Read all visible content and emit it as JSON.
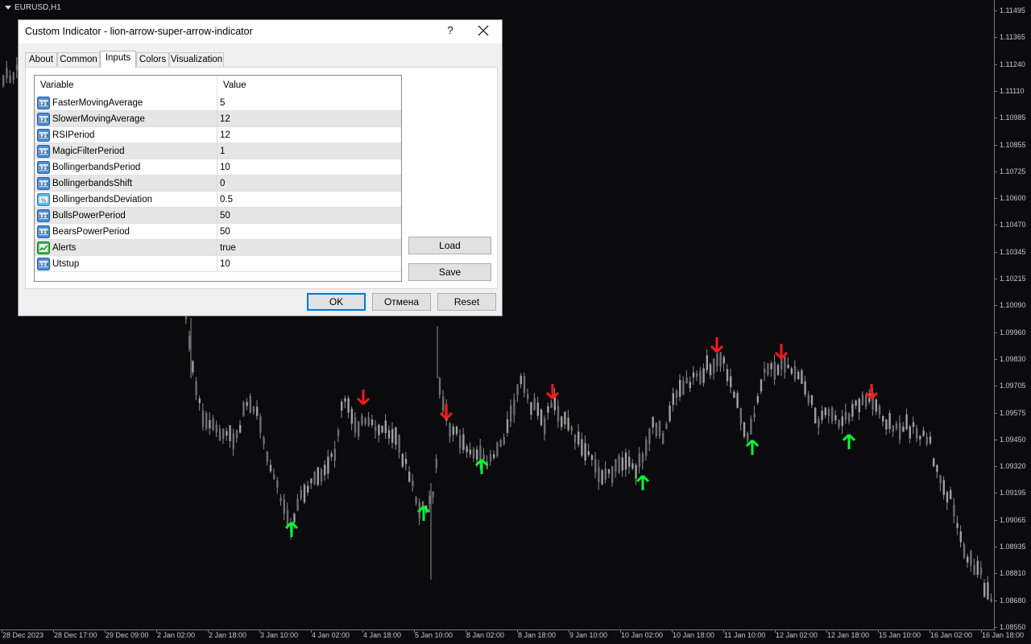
{
  "chart": {
    "symbol": "EURUSD,H1",
    "price_labels": [
      "1.11495",
      "1.11365",
      "1.11240",
      "1.11110",
      "1.10985",
      "1.10855",
      "1.10725",
      "1.10600",
      "1.10470",
      "1.10345",
      "1.10215",
      "1.10090",
      "1.09960",
      "1.09830",
      "1.09705",
      "1.09575",
      "1.09450",
      "1.09320",
      "1.09195",
      "1.09065",
      "1.08935",
      "1.08810",
      "1.08680",
      "1.08550"
    ],
    "time_labels": [
      "28 Dec 2023",
      "28 Dec 17:00",
      "29 Dec 09:00",
      "2 Jan 02:00",
      "2 Jan 18:00",
      "3 Jan 10:00",
      "4 Jan 02:00",
      "4 Jan 18:00",
      "5 Jan 10:00",
      "8 Jan 02:00",
      "8 Jan 18:00",
      "9 Jan 10:00",
      "10 Jan 02:00",
      "10 Jan 18:00",
      "11 Jan 10:00",
      "12 Jan 02:00",
      "12 Jan 18:00",
      "15 Jan 10:00",
      "16 Jan 02:00",
      "16 Jan 18:00"
    ],
    "colors": {
      "background": "#0b0b0e",
      "candle": "#8c8c8c",
      "buy_arrow": "#00ff33",
      "sell_arrow": "#ff1a1a",
      "axis_text": "#c8c8c8"
    },
    "signals": {
      "buy": [
        "3 Jan 10:00",
        "5 Jan 10:00",
        "8 Jan 02:00",
        "10 Jan 02:00",
        "11 Jan 10:00",
        "12 Jan 18:00"
      ],
      "sell": [
        "4 Jan 18:00",
        "5 Jan 10:00",
        "8 Jan 18:00",
        "10 Jan 18:00",
        "12 Jan 02:00",
        "15 Jan 10:00"
      ]
    }
  },
  "dialog": {
    "title": "Custom Indicator - lion-arrow-super-arrow-indicator",
    "help_label": "?",
    "close_icon": "close-icon",
    "tabs": [
      {
        "label": "About"
      },
      {
        "label": "Common"
      },
      {
        "label": "Inputs"
      },
      {
        "label": "Colors"
      },
      {
        "label": "Visualization"
      }
    ],
    "active_tab": "Inputs",
    "table": {
      "headers": {
        "variable": "Variable",
        "value": "Value"
      },
      "rows": [
        {
          "variable": "FasterMovingAverage",
          "value": "5",
          "icon": "integer-icon"
        },
        {
          "variable": "SlowerMovingAverage",
          "value": "12",
          "icon": "integer-icon"
        },
        {
          "variable": "RSIPeriod",
          "value": "12",
          "icon": "integer-icon"
        },
        {
          "variable": "MagicFilterPeriod",
          "value": "1",
          "icon": "integer-icon"
        },
        {
          "variable": "BollingerbandsPeriod",
          "value": "10",
          "icon": "integer-icon"
        },
        {
          "variable": "BollingerbandsShift",
          "value": "0",
          "icon": "integer-icon"
        },
        {
          "variable": "BollingerbandsDeviation",
          "value": "0.5",
          "icon": "double-icon"
        },
        {
          "variable": "BullsPowerPeriod",
          "value": "50",
          "icon": "integer-icon"
        },
        {
          "variable": "BearsPowerPeriod",
          "value": "50",
          "icon": "integer-icon"
        },
        {
          "variable": "Alerts",
          "value": "true",
          "icon": "bool-icon"
        },
        {
          "variable": "Utstup",
          "value": "10",
          "icon": "integer-icon"
        }
      ]
    },
    "buttons": {
      "load": "Load",
      "save": "Save",
      "ok": "OK",
      "cancel": "Отмена",
      "reset": "Reset"
    }
  }
}
